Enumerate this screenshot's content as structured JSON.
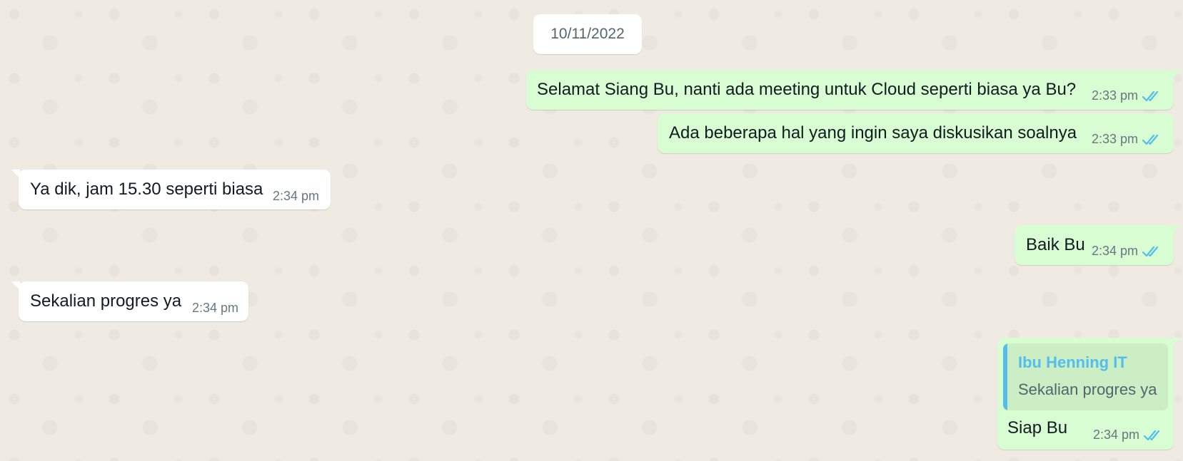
{
  "chat": {
    "date_label": "10/11/2022",
    "messages": [
      {
        "direction": "outgoing",
        "text": "Selamat Siang Bu, nanti ada meeting untuk Cloud seperti biasa ya Bu?",
        "time": "2:33 pm",
        "status": "read"
      },
      {
        "direction": "outgoing",
        "text": "Ada beberapa hal yang ingin saya diskusikan soalnya",
        "time": "2:33 pm",
        "status": "read"
      },
      {
        "direction": "incoming",
        "text": "Ya dik, jam 15.30 seperti biasa",
        "time": "2:34 pm"
      },
      {
        "direction": "outgoing",
        "text": "Baik Bu",
        "time": "2:34 pm",
        "status": "read"
      },
      {
        "direction": "incoming",
        "text": "Sekalian progres ya",
        "time": "2:34 pm"
      },
      {
        "direction": "outgoing",
        "text": "Siap Bu",
        "time": "2:34 pm",
        "status": "read",
        "reply": {
          "sender": "Ibu Henning IT",
          "text": "Sekalian progres ya"
        }
      }
    ]
  },
  "colors": {
    "background": "#efeae2",
    "outgoing_bubble": "#d9fdd3",
    "incoming_bubble": "#ffffff",
    "read_tick": "#53bdeb",
    "quote_accent": "#53bdeb",
    "meta_text": "#667781"
  },
  "icons": {
    "read_receipt": "double-check-icon"
  }
}
